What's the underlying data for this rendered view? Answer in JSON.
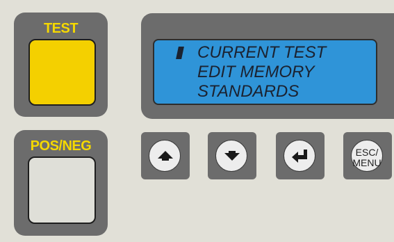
{
  "test_panel": {
    "label": "TEST"
  },
  "posneg_panel": {
    "label": "POS/NEG"
  },
  "display": {
    "cursor_icon": "block-cursor",
    "menu_items": [
      "CURRENT TEST",
      "EDIT MEMORY",
      "STANDARDS"
    ],
    "lcd_color": "#2f94d8"
  },
  "buttons": {
    "up_icon": "arrow-up-icon",
    "down_icon": "arrow-down-icon",
    "enter_icon": "enter-icon",
    "esc_line1": "ESC/",
    "esc_line2": "MENU"
  },
  "colors": {
    "background": "#e1e0d7",
    "panel": "#6c6c6c",
    "accent": "#f5d800",
    "test_key": "#f4d000"
  }
}
